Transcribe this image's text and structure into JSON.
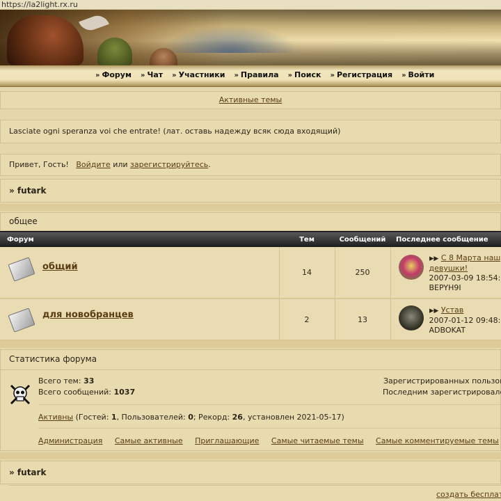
{
  "url": "https://la2light.rx.ru",
  "nav": [
    "Форум",
    "Чат",
    "Участники",
    "Правила",
    "Поиск",
    "Регистрация",
    "Войти"
  ],
  "active_topics": "Активные темы",
  "motto": "Lasciate ogni speranza voi che entrate! (лат. оставь надежду всяк сюда входящий)",
  "greeting": {
    "hello": "Привет, Гость!",
    "login": "Войдите",
    "or": "или",
    "register": "зарегистрируйтесь",
    "period": "."
  },
  "breadcrumb": "» futark",
  "category": "общее",
  "table": {
    "headers": [
      "Форум",
      "Тем",
      "Сообщений",
      "Последнее сообщение"
    ],
    "rows": [
      {
        "title": "общий",
        "topics": "14",
        "posts": "250",
        "last_title": "С 8 Марта наш",
        "last_title2": "девушки!",
        "last_date": "2007-03-09 18:54:",
        "last_user": "BEPYH9I"
      },
      {
        "title": "для новобранцев",
        "topics": "2",
        "posts": "13",
        "last_title": "Устав",
        "last_title2": "",
        "last_date": "2007-01-12 09:48:",
        "last_user": "ADBOKAT"
      }
    ]
  },
  "stats": {
    "title": "Статистика форума",
    "topics_label": "Всего тем:",
    "topics_value": "33",
    "posts_label": "Всего сообщений:",
    "posts_value": "1037",
    "registered_label": "Зарегистрированных пользов",
    "last_registered_label": "Последним зарегистрировале",
    "active_link": "Активны",
    "active_pre": "(Гостей: ",
    "guests": "1",
    "active_mid": ", Пользователей: ",
    "users": "0",
    "active_rec": "; Рекорд: ",
    "record": "26",
    "active_post": ", установлен 2021-05-17)",
    "links": [
      "Администрация",
      "Самые активные",
      "Приглашающие",
      "Самые читаемые темы",
      "Самые комментируемые темы"
    ]
  },
  "footer_breadcrumb": "» futark",
  "footer_link": "создать бесплат",
  "colors": {
    "header_dark": "#1c1c1c",
    "panel": "#e8dbb0",
    "link": "#5a3d12"
  }
}
